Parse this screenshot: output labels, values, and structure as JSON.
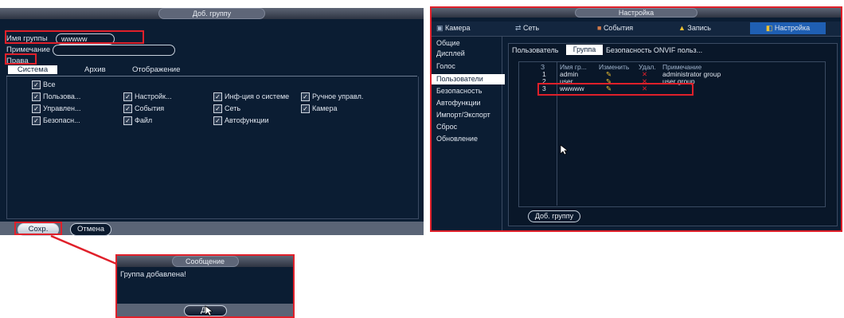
{
  "left_dialog": {
    "title": "Доб. группу",
    "group_name_label": "Имя группы",
    "group_name_value": "wwwww",
    "note_label": "Примечание",
    "note_value": "",
    "rights_label": "Права",
    "tabs": [
      "Система",
      "Архив",
      "Отображение"
    ],
    "all_label": "Все",
    "permissions": [
      "Пользова...",
      "Настройк...",
      "Инф-ция о системе",
      "Ручное управл.",
      "Управлен...",
      "События",
      "Сеть",
      "Камера",
      "Безопасн...",
      "Файл",
      "Автофункции"
    ],
    "save_label": "Сохр.",
    "cancel_label": "Отмена"
  },
  "message_dialog": {
    "title": "Сообщение",
    "text": "Группа добавлена!",
    "ok_label": "Да"
  },
  "right_window": {
    "title": "Настройка",
    "top_tabs": [
      "Камера",
      "Сеть",
      "События",
      "Запись",
      "Настройка"
    ],
    "menu": [
      "Общие",
      "Дисплей",
      "Голос",
      "Пользователи",
      "Безопасность",
      "Автофункции",
      "Импорт/Экспорт",
      "Сброс",
      "Обновление"
    ],
    "sub_tabs": [
      "Пользователь",
      "Группа",
      "Безопасность ONVIF польз..."
    ],
    "table_headers": [
      "З",
      "Имя гр...",
      "Изменить",
      "Удал.",
      "Примечание"
    ],
    "rows": [
      {
        "num": "1",
        "name": "admin",
        "edit": "✎",
        "del": "✕",
        "note": "administrator group"
      },
      {
        "num": "2",
        "name": "user",
        "edit": "✎",
        "del": "✕",
        "note": "user group"
      },
      {
        "num": "3",
        "name": "wwwww",
        "edit": "✎",
        "del": "✕",
        "note": ""
      }
    ],
    "add_group_label": "Доб. группу"
  },
  "colors": {
    "panel": "#0b1d33",
    "highlight": "#e0202a",
    "edit_icon": "#f1c232",
    "delete_icon": "#e0202a"
  }
}
